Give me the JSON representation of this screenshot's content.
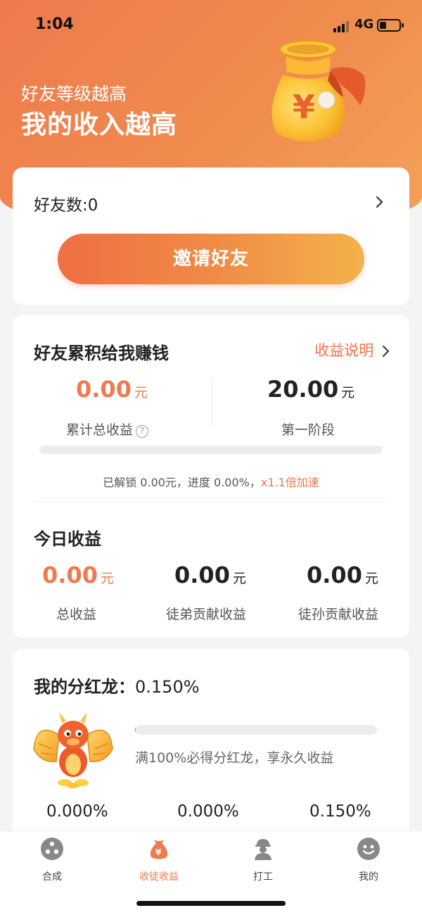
{
  "status_bar": {
    "time": "1:04",
    "network": "4G",
    "battery_level": 0.3
  },
  "hero": {
    "subtitle": "好友等级越高",
    "title": "我的收入越高",
    "bag_symbol": "¥"
  },
  "friends": {
    "label": "好友数:0",
    "invite_button": "邀请好友"
  },
  "accumulate": {
    "title": "好友累积给我赚钱",
    "explain_link": "收益说明",
    "total_value": "0.00",
    "total_unit": "元",
    "total_label": "累计总收益",
    "help_symbol": "?",
    "stage_value": "20.00",
    "stage_unit": "元",
    "stage_label": "第一阶段",
    "progress_fraction": 0.0,
    "unlock_text": "已解锁 0.00元，进度 0.00%，",
    "speed_text": "x1.1倍加速"
  },
  "today": {
    "title": "今日收益",
    "items": [
      {
        "value": "0.00",
        "unit": "元",
        "label": "总收益"
      },
      {
        "value": "0.00",
        "unit": "元",
        "label": "徒弟贡献收益"
      },
      {
        "value": "0.00",
        "unit": "元",
        "label": "徒孙贡献收益"
      }
    ]
  },
  "dragon": {
    "title": "我的分红龙：",
    "percent": "0.150%",
    "progress_fraction": 0.0015,
    "hint": "满100%必得分红龙，享永久收益",
    "stats": [
      "0.000%",
      "0.000%",
      "0.150%"
    ]
  },
  "tabbar": {
    "tabs": [
      {
        "label": "合成",
        "icon": "compose-icon",
        "active": false
      },
      {
        "label": "收徒收益",
        "icon": "money-bag-icon",
        "active": true
      },
      {
        "label": "打工",
        "icon": "worker-icon",
        "active": false
      },
      {
        "label": "我的",
        "icon": "profile-icon",
        "active": false
      }
    ],
    "active_color": "#ee7a4e"
  },
  "colors": {
    "accent": "#ee7a4e",
    "accent_light": "#f3b24b"
  }
}
